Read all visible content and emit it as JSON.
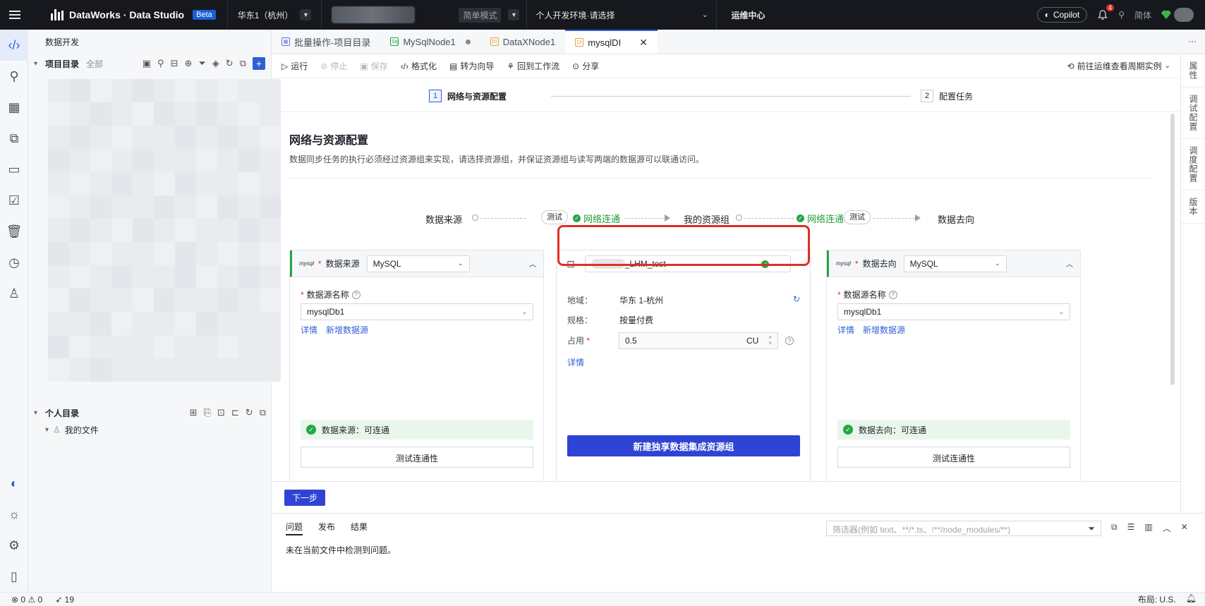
{
  "topbar": {
    "brand": "DataWorks · Data Studio",
    "beta": "Beta",
    "region": "华东1（杭州）",
    "mode": "简单模式",
    "env": "个人开发环境·请选择",
    "ops": "运维中心",
    "copilot": "Copilot",
    "notif_count": "4",
    "lang": "简体"
  },
  "explorer": {
    "title": "数据开发",
    "project_dir": "项目目录",
    "project_filter": "全部",
    "personal_dir": "个人目录",
    "my_files": "我的文件"
  },
  "tabs": [
    {
      "label": "批量操作-项目目录",
      "icon": "batch-icon"
    },
    {
      "label": "MySqlNode1",
      "icon": "sq-icon"
    },
    {
      "label": "DataXNode1",
      "icon": "di-icon"
    },
    {
      "label": "mysqlDI",
      "icon": "di-icon"
    }
  ],
  "toolbar": {
    "run": "运行",
    "stop": "停止",
    "save": "保存",
    "format": "格式化",
    "to_wizard": "转为向导",
    "back_workflow": "回到工作流",
    "share": "分享",
    "goto_ops": "前往运维查看周期实例"
  },
  "right_panel": [
    "属性",
    "调试配置",
    "调度配置",
    "版本"
  ],
  "steps": [
    {
      "num": "1",
      "label": "网络与资源配置"
    },
    {
      "num": "2",
      "label": "配置任务"
    }
  ],
  "main": {
    "title": "网络与资源配置",
    "desc": "数据同步任务的执行必须经过资源组来实现，请选择资源组，并保证资源组与读写两端的数据源可以联通访问。"
  },
  "flow": {
    "source": "数据来源",
    "test": "测试",
    "connected": "网络连通",
    "my_group": "我的资源组",
    "target": "数据去向"
  },
  "source_card": {
    "logo": "mysql",
    "label": "数据来源",
    "type": "MySQL",
    "ds_label": "数据源名称",
    "ds_value": "mysqlDb1",
    "detail": "详情",
    "add_ds": "新增数据源",
    "status": "数据来源：可连通",
    "test_btn": "测试连通性"
  },
  "resource_card": {
    "group_name": "_LHM_test",
    "region_k": "地域：",
    "region_v": "华东 1-杭州",
    "spec_k": "规格：",
    "spec_v": "按量付费",
    "usage_k": "占用",
    "usage_v": "0.5",
    "unit": "CU",
    "detail": "详情",
    "create_btn": "新建独享数据集成资源组"
  },
  "target_card": {
    "logo": "mysql",
    "label": "数据去向",
    "type": "MySQL",
    "ds_label": "数据源名称",
    "ds_value": "mysqlDb1",
    "detail": "详情",
    "add_ds": "新增数据源",
    "status": "数据去向：可连通",
    "test_btn": "测试连通性"
  },
  "next_btn": "下一步",
  "panel": {
    "tabs": [
      "问题",
      "发布",
      "结果"
    ],
    "message": "未在当前文件中检测到问题。",
    "filter_placeholder": "筛选器(例如 text、**/*.ts、!**/node_modules/**)"
  },
  "statusbar": {
    "errors": "0",
    "warnings": "0",
    "sends": "19",
    "layout": "布局: U.S."
  }
}
